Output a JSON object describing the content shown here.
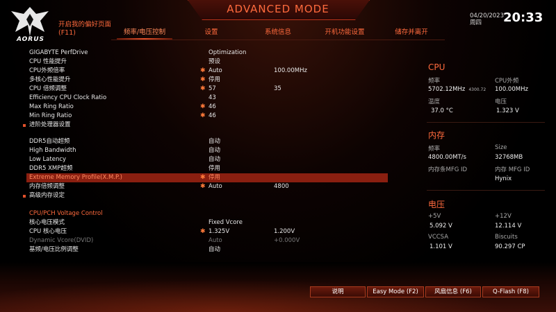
{
  "header": {
    "mode_title": "ADVANCED MODE",
    "logo_text": "AORUS",
    "favorite_line1": "开启我的偏好页面",
    "favorite_line2": "(F11)",
    "date": "04/20/2023",
    "weekday": "周四",
    "time": "20:33"
  },
  "tabs": [
    {
      "label": "频率/电压控制",
      "active": true
    },
    {
      "label": "设置",
      "active": false
    },
    {
      "label": "系统信息",
      "active": false
    },
    {
      "label": "开机功能设置",
      "active": false
    },
    {
      "label": "储存并离开",
      "active": false
    }
  ],
  "settings": [
    {
      "label": "GIGABYTE PerfDrive",
      "star": "",
      "value": "Optimization",
      "value2": ""
    },
    {
      "label": "CPU 性能提升",
      "star": "",
      "value": "预设",
      "value2": ""
    },
    {
      "label": "CPU外频倍率",
      "star": "✱",
      "value": "Auto",
      "value2": "100.00MHz"
    },
    {
      "label": "多核心性能提升",
      "star": "✱",
      "value": "停用",
      "value2": ""
    },
    {
      "label": "CPU 倍频调整",
      "star": "✱",
      "value": "57",
      "value2": "35"
    },
    {
      "label": "Efficiency CPU Clock Ratio",
      "star": "",
      "value": "43",
      "value2": ""
    },
    {
      "label": "Max Ring Ratio",
      "star": "✱",
      "value": "46",
      "value2": ""
    },
    {
      "label": "Min Ring Ratio",
      "star": "✱",
      "value": "46",
      "value2": ""
    },
    {
      "label": "进阶处理器设置",
      "star": "",
      "value": "",
      "value2": "",
      "submenu": true
    },
    {
      "label": "DDR5自动超频",
      "star": "",
      "value": "自动",
      "value2": ""
    },
    {
      "label": "High Bandwidth",
      "star": "",
      "value": "自动",
      "value2": ""
    },
    {
      "label": "Low Latency",
      "star": "",
      "value": "自动",
      "value2": ""
    },
    {
      "label": "DDR5 XMP超频",
      "star": "",
      "value": "停用",
      "value2": ""
    },
    {
      "label": "Extreme Memory Profile(X.M.P.)",
      "star": "✱",
      "value": "停用",
      "value2": "",
      "highlight": true
    },
    {
      "label": "内存倍频调整",
      "star": "✱",
      "value": "Auto",
      "value2": "4800"
    },
    {
      "label": "高级内存设定",
      "star": "",
      "value": "",
      "value2": "",
      "submenu": true
    },
    {
      "label": "CPU/PCH Voltage Control",
      "star": "",
      "value": "",
      "value2": "",
      "section": true
    },
    {
      "label": "核心电压模式",
      "star": "",
      "value": "Fixed Vcore",
      "value2": ""
    },
    {
      "label": "CPU 核心电压",
      "star": "✱",
      "value": "1.325V",
      "value2": "1.200V"
    },
    {
      "label": "Dynamic Vcore(DVID)",
      "star": "",
      "value": "Auto",
      "value2": "+0.000V",
      "dim": true
    },
    {
      "label": "基频/电压比例调整",
      "star": "",
      "value": "自动",
      "value2": ""
    }
  ],
  "monitor": {
    "cpu": {
      "title": "CPU",
      "freq_label": "频率",
      "freq_value": "5702.12MHz",
      "freq_small": "4300.72",
      "bclk_label": "CPU外频",
      "bclk_value": "100.00MHz",
      "temp_label": "温度",
      "temp_value": "37.0 °C",
      "volt_label": "电压",
      "volt_value": "1.323 V"
    },
    "memory": {
      "title": "内存",
      "freq_label": "频率",
      "freq_value": "4800.00MT/s",
      "size_label": "Size",
      "size_value": "32768MB",
      "mfg_label": "内存条MFG ID",
      "mfg2_label": "内存 MFG ID",
      "mfg2_value": "Hynix"
    },
    "voltage": {
      "title": "电压",
      "p5v_label": "+5V",
      "p5v_value": "5.092 V",
      "p12v_label": "+12V",
      "p12v_value": "12.114 V",
      "vccsa_label": "VCCSA",
      "vccsa_value": "1.101 V",
      "biscuits_label": "Biscuits",
      "biscuits_value": "90.297 CP"
    }
  },
  "buttons": [
    {
      "name": "help-button",
      "label": "说明"
    },
    {
      "name": "easy-mode-button",
      "label": "Easy Mode (F2)"
    },
    {
      "name": "fan-info-button",
      "label": "风扇信息 (F6)"
    },
    {
      "name": "qflash-button",
      "label": "Q-Flash (F8)"
    }
  ]
}
